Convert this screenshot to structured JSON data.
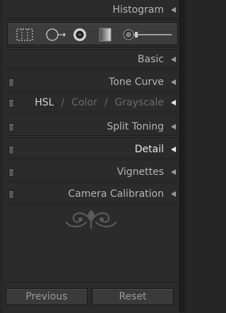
{
  "panels": {
    "histogram": "Histogram",
    "basic": "Basic",
    "tone_curve": "Tone Curve",
    "hsl_tabs": [
      "HSL",
      "Color",
      "Grayscale"
    ],
    "slash": "/",
    "split_toning": "Split Toning",
    "detail": "Detail",
    "vignettes": "Vignettes",
    "camera_calibration": "Camera Calibration"
  },
  "buttons": {
    "previous": "Previous",
    "reset": "Reset"
  },
  "tools": [
    "crop-overlay-icon",
    "spot-removal-icon",
    "red-eye-icon",
    "graduated-filter-icon",
    "adjustment-brush-icon"
  ],
  "colors": {
    "panel_bg": "#2b2b2b",
    "text": "#b4b4b4",
    "active_text": "#e8e8e8",
    "dim_text": "#6a6a6a"
  }
}
